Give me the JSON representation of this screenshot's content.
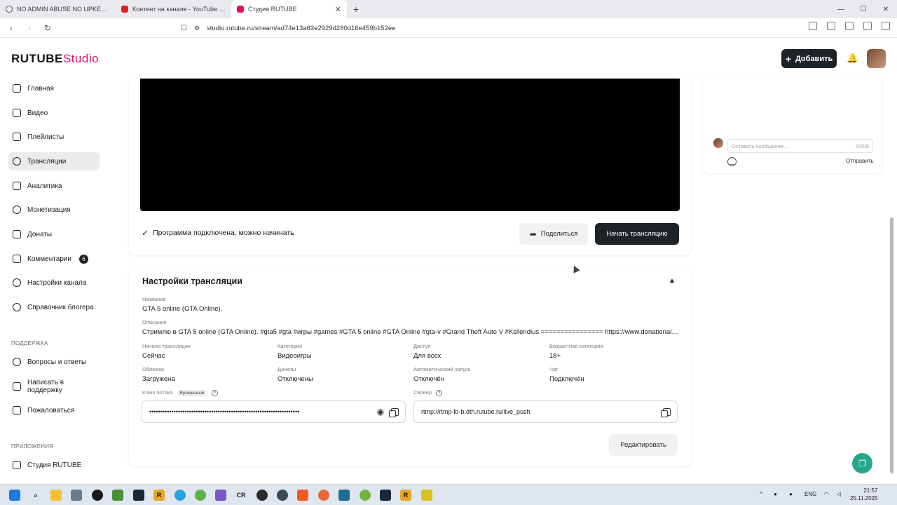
{
  "browser": {
    "tabs": [
      {
        "label": "NO ADMIN ABUSE NO UPKEEP SOFT",
        "color": "#555555",
        "active": false
      },
      {
        "label": "Контент на канале - YouTube Studio",
        "color": "#e02020",
        "active": false
      },
      {
        "label": "Студия RUTUBE",
        "color": "#e0105f",
        "active": true
      }
    ],
    "url": "studio.rutube.ru/stream/ad74e13a63e2929d280d16e459b152ee"
  },
  "header": {
    "logo_main": "RUTUBE",
    "logo_studio": "Studio",
    "add_button": "Добавить"
  },
  "sidebar": {
    "items": [
      {
        "label": "Главная",
        "icon": "home-icon"
      },
      {
        "label": "Видео",
        "icon": "video-icon"
      },
      {
        "label": "Плейлисты",
        "icon": "playlist-icon"
      },
      {
        "label": "Трансляции",
        "icon": "broadcast-icon",
        "active": true
      },
      {
        "label": "Аналитика",
        "icon": "analytics-icon"
      },
      {
        "label": "Монетизация",
        "icon": "monetization-icon"
      },
      {
        "label": "Донаты",
        "icon": "donate-icon"
      },
      {
        "label": "Комментарии",
        "icon": "comments-icon",
        "badge": "6"
      },
      {
        "label": "Настройки канала",
        "icon": "gear-icon"
      },
      {
        "label": "Справочник блогера",
        "icon": "info-icon"
      }
    ],
    "support_heading": "ПОДДЕРЖКА",
    "support_items": [
      {
        "label": "Вопросы и ответы",
        "icon": "faq-icon"
      },
      {
        "label": "Написать в поддержку",
        "icon": "mail-icon"
      },
      {
        "label": "Пожаловаться",
        "icon": "flag-icon"
      }
    ],
    "apps_heading": "ПРИЛОЖЕНИЯ",
    "apps_items": [
      {
        "label": "Студия RUTUBE",
        "icon": "studio-app-icon"
      }
    ]
  },
  "stream": {
    "status_text": "Программа подключена, можно начинать",
    "share_button": "Поделиться",
    "start_button": "Начать трансляцию"
  },
  "settings": {
    "title": "Настройки трансляции",
    "name_label": "Название",
    "name_value": "GTA 5 online (GTA Online).",
    "desc_label": "Описание",
    "desc_value": "Стримлю в GTA 5 online (GTA Online). #gta5 #gta #игры #games #GTA 5 online #GTA Online #gta-v #Grand Theft Auto V #Ksllendius ================ https://www.donationalert...",
    "start_label": "Начало трансляции",
    "start_value": "Сейчас",
    "category_label": "Категория",
    "category_value": "Видеоигры",
    "access_label": "Доступ",
    "access_value": "Для всех",
    "age_label": "Возрастная категория",
    "age_value": "18+",
    "cover_label": "Обложка",
    "cover_value": "Загружена",
    "donates_label": "Донаты",
    "donates_value": "Отключены",
    "autostart_label": "Автоматический запуск",
    "autostart_value": "Отключён",
    "chat_label": "Чат",
    "chat_value": "Подключён",
    "key_label": "Ключ потока",
    "key_badge": "Временный",
    "key_value": "••••••••••••••••••••••••••••••••••••••••••••••••••••••••••••••••••••",
    "server_label": "Сервер",
    "server_value": "rtmp://rtmp-lb-b.dth.rutube.ru/live_push",
    "edit_button": "Редактировать"
  },
  "chat": {
    "placeholder": "Оставить сообщение...",
    "counter": "0/200",
    "send_button": "Отправить"
  },
  "taskbar": {
    "lang": "ENG",
    "time": "21:57",
    "date": "25.11.2025"
  }
}
